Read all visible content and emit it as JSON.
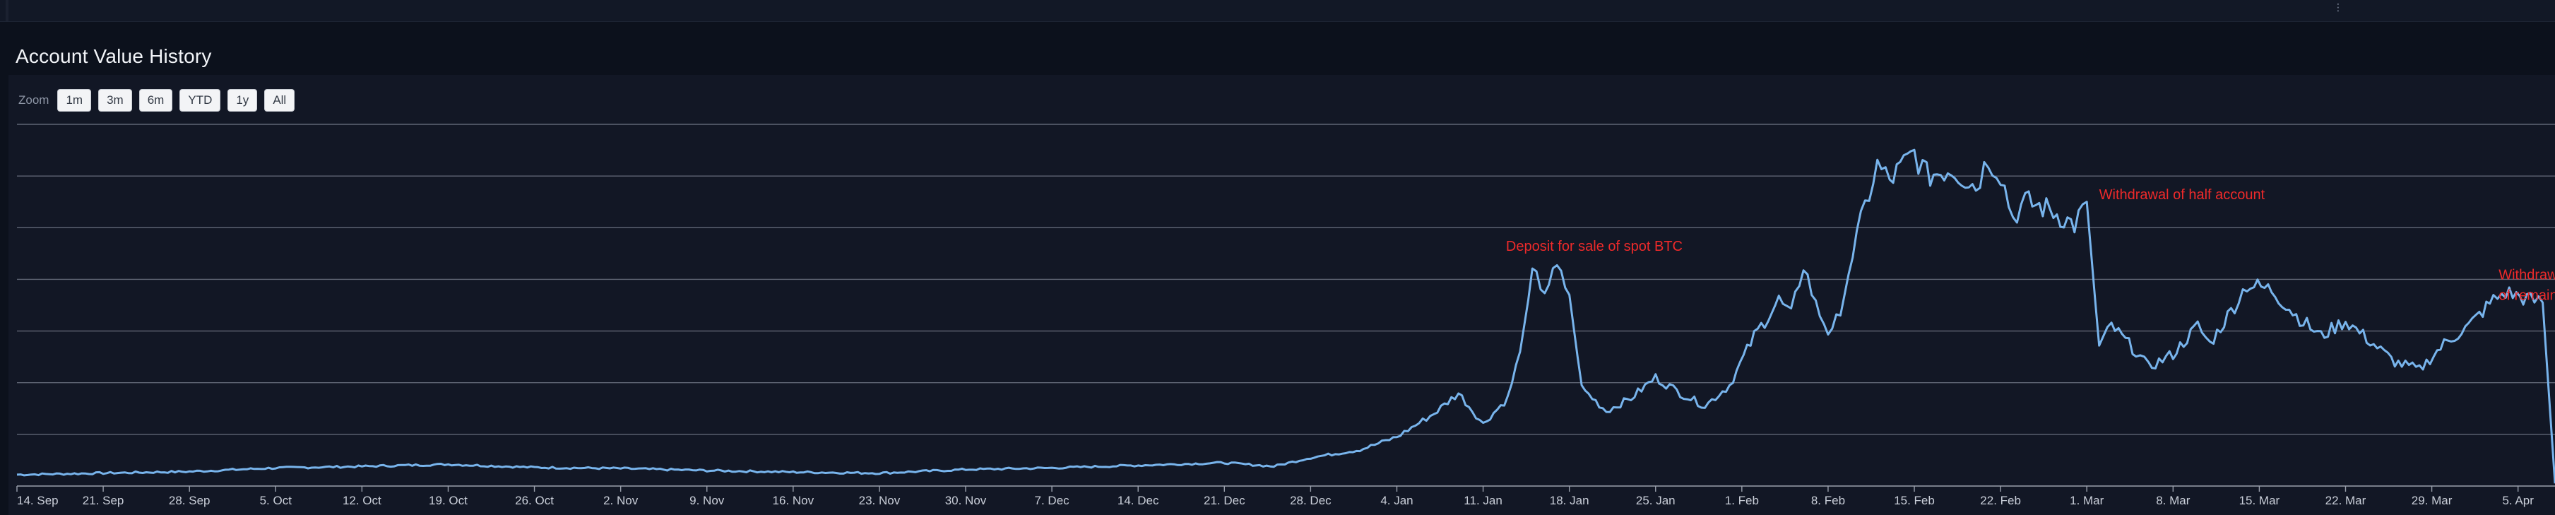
{
  "header": {
    "title": "Account Value History"
  },
  "zoom": {
    "label": "Zoom",
    "buttons": [
      "1m",
      "3m",
      "6m",
      "YTD",
      "1y",
      "All"
    ],
    "selected": "All"
  },
  "colors": {
    "background": "#0c111c",
    "panel": "#121725",
    "series": "#78b4ec",
    "annotation": "#ee2a2a",
    "grid": "#7b8190"
  },
  "chart_data": {
    "type": "line",
    "title": "",
    "xlabel": "",
    "ylabel": "",
    "y_axis_labels_visible": false,
    "grid": true,
    "ylim": [
      0,
      7
    ],
    "y_gridlines": [
      1,
      2,
      3,
      4,
      5,
      6,
      7
    ],
    "x_range": [
      "2023-09-14",
      "2024-04-07"
    ],
    "x_tick_labels": [
      "14. Sep",
      "21. Sep",
      "28. Sep",
      "5. Oct",
      "12. Oct",
      "19. Oct",
      "26. Oct",
      "2. Nov",
      "9. Nov",
      "16. Nov",
      "23. Nov",
      "30. Nov",
      "7. Dec",
      "14. Dec",
      "21. Dec",
      "28. Dec",
      "4. Jan",
      "11. Jan",
      "18. Jan",
      "25. Jan",
      "1. Feb",
      "8. Feb",
      "15. Feb",
      "22. Feb",
      "1. Mar",
      "8. Mar",
      "15. Mar",
      "22. Mar",
      "29. Mar",
      "5. Apr"
    ],
    "series": [
      {
        "name": "",
        "points": [
          [
            "2023-09-14",
            0.22
          ],
          [
            "2023-09-21",
            0.25
          ],
          [
            "2023-09-28",
            0.28
          ],
          [
            "2023-10-05",
            0.35
          ],
          [
            "2023-10-12",
            0.38
          ],
          [
            "2023-10-19",
            0.42
          ],
          [
            "2023-10-26",
            0.36
          ],
          [
            "2023-11-02",
            0.34
          ],
          [
            "2023-11-09",
            0.3
          ],
          [
            "2023-11-16",
            0.27
          ],
          [
            "2023-11-23",
            0.25
          ],
          [
            "2023-11-30",
            0.32
          ],
          [
            "2023-12-07",
            0.35
          ],
          [
            "2023-12-14",
            0.4
          ],
          [
            "2023-12-21",
            0.45
          ],
          [
            "2023-12-25",
            0.38
          ],
          [
            "2023-12-28",
            0.55
          ],
          [
            "2024-01-01",
            0.7
          ],
          [
            "2024-01-04",
            0.95
          ],
          [
            "2024-01-07",
            1.4
          ],
          [
            "2024-01-09",
            1.8
          ],
          [
            "2024-01-11",
            1.2
          ],
          [
            "2024-01-13",
            1.7
          ],
          [
            "2024-01-14",
            2.6
          ],
          [
            "2024-01-15",
            4.1
          ],
          [
            "2024-01-16",
            3.8
          ],
          [
            "2024-01-17",
            4.2
          ],
          [
            "2024-01-18",
            3.7
          ],
          [
            "2024-01-19",
            1.9
          ],
          [
            "2024-01-21",
            1.45
          ],
          [
            "2024-01-23",
            1.7
          ],
          [
            "2024-01-25",
            2.1
          ],
          [
            "2024-01-27",
            1.8
          ],
          [
            "2024-01-29",
            1.55
          ],
          [
            "2024-01-31",
            1.95
          ],
          [
            "2024-02-02",
            2.9
          ],
          [
            "2024-02-04",
            3.6
          ],
          [
            "2024-02-05",
            3.3
          ],
          [
            "2024-02-06",
            4.3
          ],
          [
            "2024-02-07",
            3.5
          ],
          [
            "2024-02-08",
            3.0
          ],
          [
            "2024-02-09",
            3.3
          ],
          [
            "2024-02-10",
            4.5
          ],
          [
            "2024-02-11",
            5.4
          ],
          [
            "2024-02-12",
            6.2
          ],
          [
            "2024-02-13",
            5.9
          ],
          [
            "2024-02-15",
            6.45
          ],
          [
            "2024-02-16",
            6.0
          ],
          [
            "2024-02-18",
            6.15
          ],
          [
            "2024-02-20",
            5.8
          ],
          [
            "2024-02-21",
            6.35
          ],
          [
            "2024-02-22",
            6.05
          ],
          [
            "2024-02-23",
            5.2
          ],
          [
            "2024-02-24",
            5.5
          ],
          [
            "2024-02-26",
            5.35
          ],
          [
            "2024-02-28",
            5.05
          ],
          [
            "2024-02-29",
            5.5
          ],
          [
            "2024-03-01",
            2.7
          ],
          [
            "2024-03-02",
            3.1
          ],
          [
            "2024-03-04",
            2.6
          ],
          [
            "2024-03-05",
            2.3
          ],
          [
            "2024-03-07",
            2.55
          ],
          [
            "2024-03-09",
            3.1
          ],
          [
            "2024-03-10",
            2.75
          ],
          [
            "2024-03-12",
            3.5
          ],
          [
            "2024-03-13",
            3.9
          ],
          [
            "2024-03-15",
            3.8
          ],
          [
            "2024-03-17",
            3.3
          ],
          [
            "2024-03-19",
            2.9
          ],
          [
            "2024-03-21",
            3.2
          ],
          [
            "2024-03-23",
            2.8
          ],
          [
            "2024-03-25",
            2.4
          ],
          [
            "2024-03-27",
            2.25
          ],
          [
            "2024-03-29",
            2.75
          ],
          [
            "2024-03-31",
            3.1
          ],
          [
            "2024-04-02",
            3.6
          ],
          [
            "2024-04-03",
            3.75
          ],
          [
            "2024-04-05",
            3.6
          ],
          [
            "2024-04-06",
            3.55
          ],
          [
            "2024-04-07",
            0.05
          ]
        ]
      }
    ],
    "annotations": [
      {
        "text": "Deposit for sale of spot BTC",
        "date": "2024-01-14",
        "value": 4.55
      },
      {
        "text": "Withdrawal of half account",
        "date": "2024-03-01",
        "value": 5.55
      },
      {
        "text": "Withdrawal",
        "date": "2024-04-03",
        "value": 4.0
      },
      {
        "text": "of remainder",
        "date": "2024-04-03",
        "value": 3.6
      }
    ]
  }
}
